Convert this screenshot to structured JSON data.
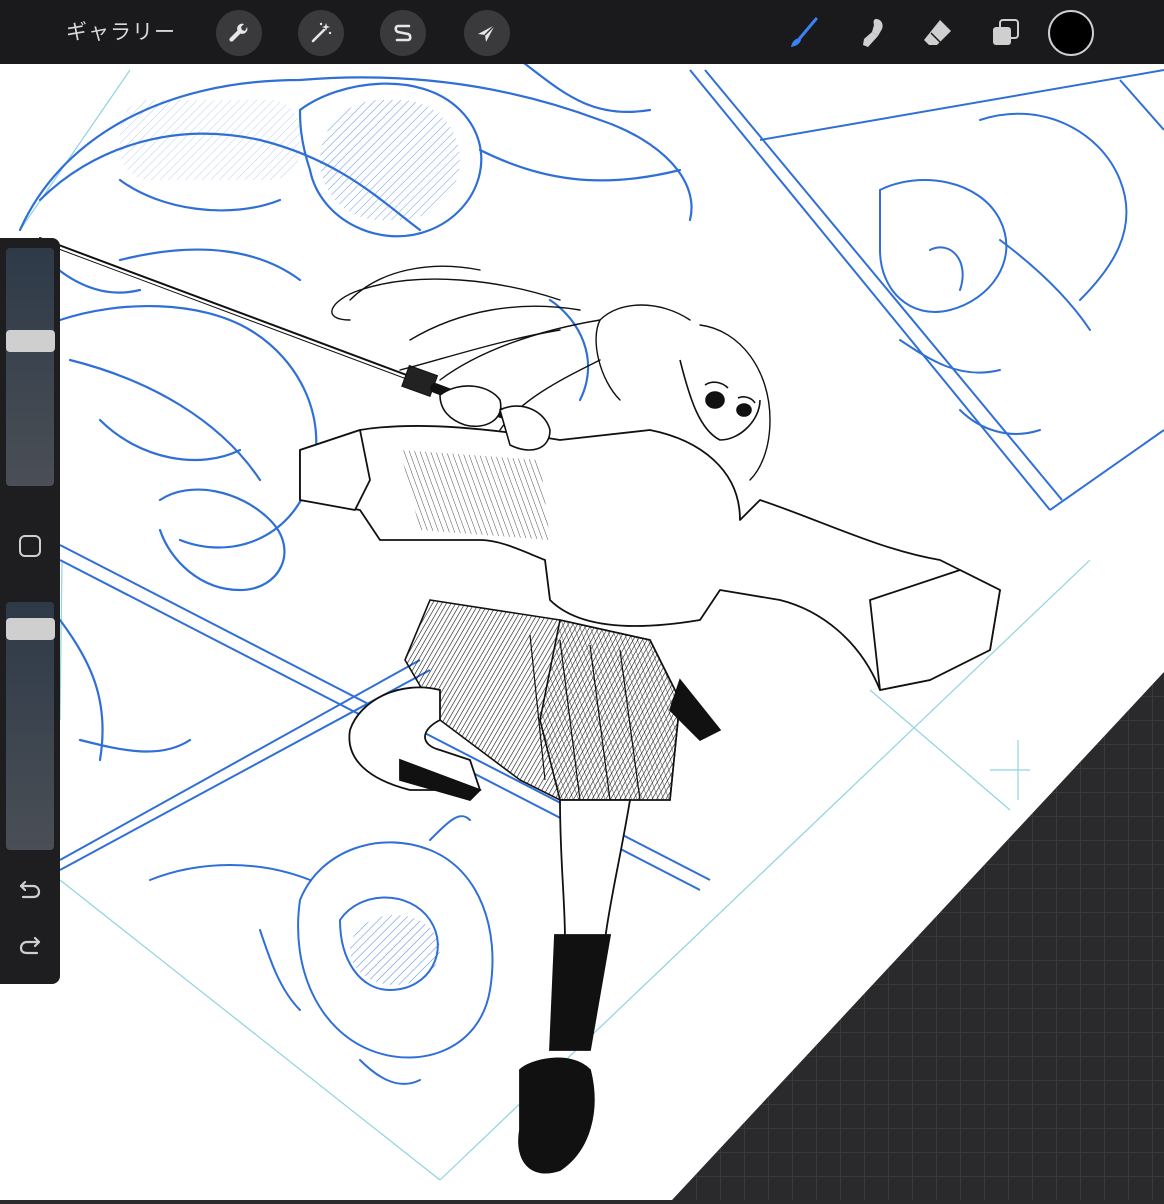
{
  "toolbar": {
    "gallery_label": "ギャラリー",
    "actions_icon": "wrench-icon",
    "adjustments_icon": "magic-wand-icon",
    "selection_icon": "selection-s-icon",
    "transform_icon": "arrow-cursor-icon",
    "brush_icon": "brush-icon",
    "smudge_icon": "smudge-finger-icon",
    "eraser_icon": "eraser-icon",
    "layers_icon": "layers-icon",
    "current_color": "#000000",
    "active_tool_color": "#3a82f7"
  },
  "sidebar": {
    "brush_size_level": 0.62,
    "opacity_level": 0.93,
    "modifier_icon": "square-modifier-icon",
    "undo_icon": "undo-arrow-icon",
    "redo_icon": "redo-arrow-icon"
  },
  "colors": {
    "sketch_blue": "#2f6fd6",
    "ink": "#111111",
    "guide_cyan": "#8fd3e0",
    "workspace": "#2a2a2c"
  }
}
